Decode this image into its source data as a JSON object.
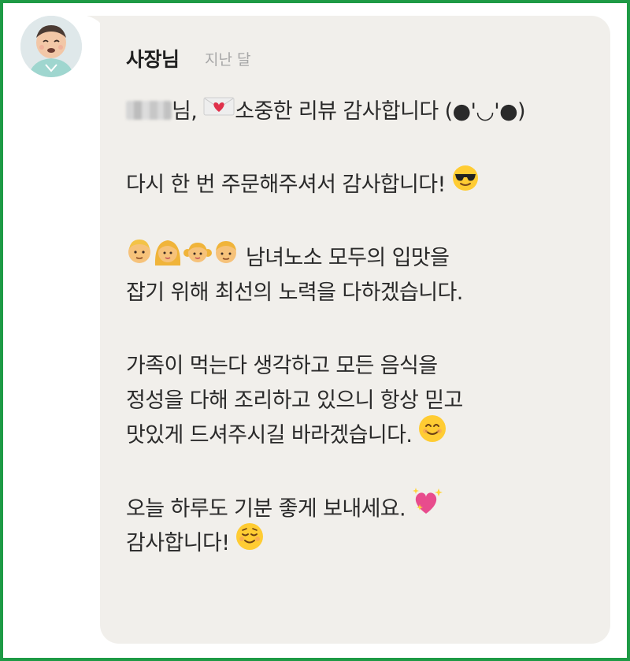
{
  "review_reply": {
    "author": "사장님",
    "timestamp": "지난 달",
    "avatar_icon": "owner-avatar-icon",
    "lines": {
      "l1_after_name": "님, ",
      "l1_rest": "소중한 리뷰 감사합니다 (●'◡'●)",
      "l2": "다시 한 번 주문해주셔서 감사합니다! ",
      "l3": " 남녀노소 모두의 입맛을",
      "l4": "잡기 위해 최선의 노력을 다하겠습니다.",
      "l5": "가족이 먹는다 생각하고 모든 음식을",
      "l6": "정성을 다해 조리하고 있으니 항상 믿고",
      "l7": "맛있게 드셔주시길 바라겠습니다. ",
      "l8": "오늘 하루도 기분 좋게 보내세요. ",
      "l9": "감사합니다! "
    },
    "icons": {
      "redacted_name": "blurred-username",
      "love_letter": "love-letter-icon",
      "sunglasses": "sunglasses-face-icon",
      "man": "man-face-icon",
      "woman": "woman-face-icon",
      "girl": "girl-face-icon",
      "boy": "boy-face-icon",
      "smile": "smiling-face-icon",
      "sparkling_heart": "sparkling-heart-icon",
      "relieved": "relieved-face-icon"
    },
    "colors": {
      "frame": "#1e9a45",
      "bubble": "#f1efeb",
      "text": "#2a2a2a",
      "timestamp": "#a7a7a7"
    }
  }
}
